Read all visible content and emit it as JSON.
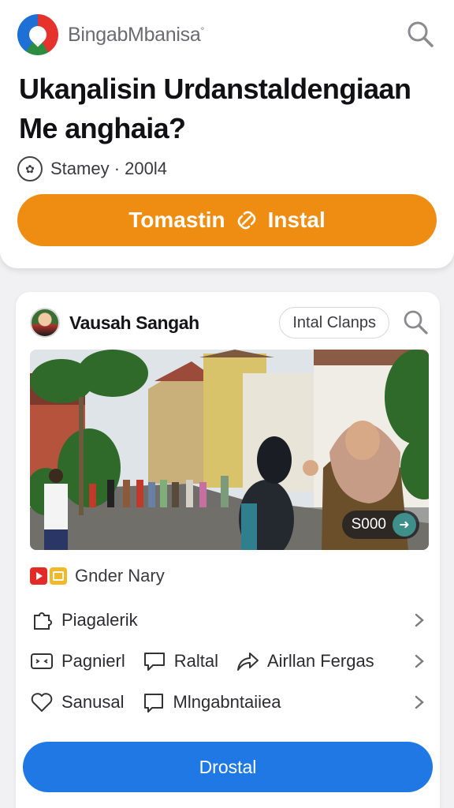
{
  "brand": {
    "name": "BingabMbanisa",
    "trademark": "°",
    "logo_icon": "brand-logo-icon"
  },
  "headline": "Ukaŋalisin Urdanstaldengiaan Me anghaia?",
  "meta": {
    "icon": "badge-icon",
    "text": "Stamey · 200l4"
  },
  "cta": {
    "label_left": "Tomastin",
    "label_right": "Instal",
    "icon": "link-icon",
    "color": "#ef8d12"
  },
  "post": {
    "author": "Vausah Sangah",
    "chip_label": "Intal Clanps",
    "photo_price": "S000",
    "source_label": "Gnder Nary"
  },
  "menu": {
    "row1": [
      {
        "label": "Piagalerik",
        "icon": "puzzle-icon"
      }
    ],
    "row2": [
      {
        "label": "Pagnierl",
        "icon": "caption-icon"
      },
      {
        "label": "Raltal",
        "icon": "comment-icon"
      },
      {
        "label": "Airllan Fergas",
        "icon": "share-icon"
      }
    ],
    "row3": [
      {
        "label": "Sanusal",
        "icon": "heart-icon"
      },
      {
        "label": "Mlngabntaiiea",
        "icon": "chat-bubble-icon"
      }
    ]
  },
  "primary_button": {
    "label": "Drostal",
    "color": "#1f78e3"
  }
}
